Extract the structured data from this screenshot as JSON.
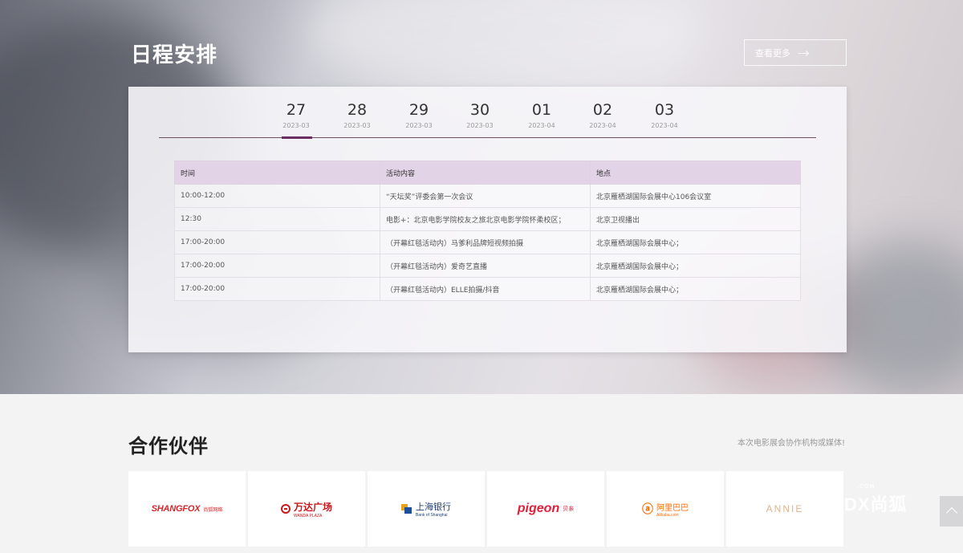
{
  "schedule": {
    "title": "日程安排",
    "more_label": "查看更多",
    "tabs": [
      {
        "day": "27",
        "ym": "2023-03",
        "active": true
      },
      {
        "day": "28",
        "ym": "2023-03"
      },
      {
        "day": "29",
        "ym": "2023-03"
      },
      {
        "day": "30",
        "ym": "2023-03"
      },
      {
        "day": "01",
        "ym": "2023-04"
      },
      {
        "day": "02",
        "ym": "2023-04"
      },
      {
        "day": "03",
        "ym": "2023-04"
      }
    ],
    "table": {
      "headers": [
        "时间",
        "活动内容",
        "地点"
      ],
      "rows": [
        [
          "10:00-12:00",
          "“天坛奖”评委会第一次会议",
          "北京雁栖湖国际会展中心106会议室"
        ],
        [
          "12:30",
          "电影+：北京电影学院校友之旅北京电影学院怀柔校区；",
          "北京卫视播出"
        ],
        [
          "17:00-20:00",
          "（开幕红毯活动内）马爹利品牌短视频拍摄",
          "北京雁栖湖国际会展中心；"
        ],
        [
          "17:00-20:00",
          "（开幕红毯活动内）爱奇艺直播",
          "北京雁栖湖国际会展中心；"
        ],
        [
          "17:00-20:00",
          "（开幕红毯活动内）ELLE拍摄/抖音",
          "北京雁栖湖国际会展中心；"
        ]
      ]
    }
  },
  "partners": {
    "title": "合作伙伴",
    "description": "本次电影展会协作机构或媒体!",
    "logos": [
      {
        "name": "SHANGFOX",
        "sub": "尚狐网络"
      },
      {
        "name": "万达广场",
        "sub": "WANDA PLAZA"
      },
      {
        "name": "上海银行",
        "sub": "Bank of Shanghai"
      },
      {
        "name": "pigeon",
        "sub": "贝亲"
      },
      {
        "name": "阿里巴巴",
        "sub": "Alibaba.com"
      },
      {
        "name": "ANNIE"
      }
    ]
  },
  "watermark": {
    "text": "DX尚狐",
    "small": ".COM"
  },
  "colors": {
    "accent": "#6b2e63",
    "table_header": "#e2d3e6",
    "brand_red": "#d4262b"
  },
  "icons": {
    "more": "arrow-right-icon",
    "back_to_top": "chevron-up-icon"
  }
}
